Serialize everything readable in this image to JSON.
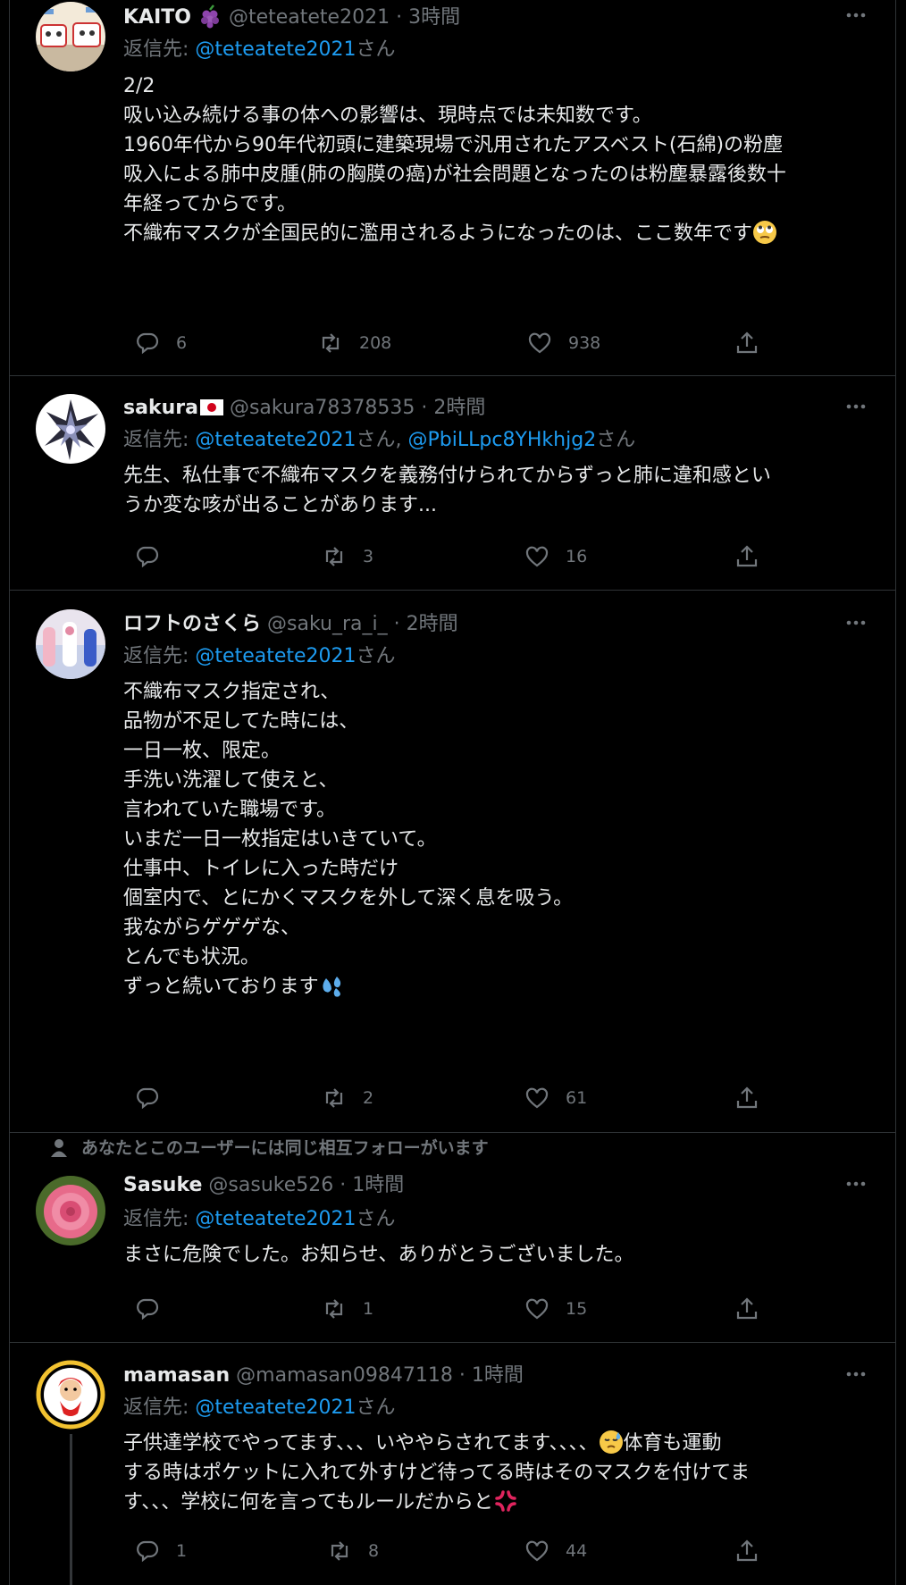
{
  "tweets": [
    {
      "name": "KAITO",
      "handle": "@teteatete2021",
      "time": "· 3時間",
      "reply_prefix": "返信先: ",
      "reply_mentions": "@teteatete2021",
      "reply_suffix": "さん",
      "lines": [
        "2/2",
        "吸い込み続ける事の体への影響は、現時点では未知数です。",
        "",
        "1960年代から90年代初頭に建築現場で汎用されたアスベスト(石綿)の粉塵",
        "吸入による肺中皮腫(肺の胸膜の癌)が社会問題となったのは粉塵暴露後数十",
        "年経ってからです。",
        "",
        "不織布マスクが全国民的に濫用されるようになったのは、ここ数年です"
      ],
      "replies": "6",
      "retweets": "208",
      "likes": "938",
      "name_emoji": "grapes-emoji",
      "end_emoji": "face-with-rolling-eyes-emoji"
    },
    {
      "name": "sakura",
      "handle": "@sakura78378535",
      "time": "· 2時間",
      "reply_prefix": "返信先: ",
      "reply_mentions": "@teteatete2021",
      "reply_mid": "さん, ",
      "reply_mentions2": "@PbiLLpc8YHkhjg2",
      "reply_suffix": "さん",
      "lines": [
        "先生、私仕事で不織布マスクを義務付けられてからずっと肺に違和感とい",
        "うか変な咳が出ることがあります..."
      ],
      "replies": "",
      "retweets": "3",
      "likes": "16",
      "name_emoji": "japan-flag-emoji"
    },
    {
      "name": "ロフトのさくら",
      "handle": "@saku_ra_i_",
      "time": "· 2時間",
      "reply_prefix": "返信先: ",
      "reply_mentions": "@teteatete2021",
      "reply_suffix": "さん",
      "lines": [
        "不織布マスク指定され、",
        "品物が不足してた時には、",
        "一日一枚、限定。",
        "手洗い洗濯して使えと、",
        "言われていた職場です。",
        "",
        "いまだ一日一枚指定はいきていて。",
        "",
        "仕事中、トイレに入った時だけ",
        "個室内で、とにかくマスクを外して深く息を吸う。",
        "我ながらゲゲゲな、",
        "とんでも状況。",
        "ずっと続いております"
      ],
      "replies": "",
      "retweets": "2",
      "likes": "61",
      "end_emoji": "sweat-droplets-emoji"
    },
    {
      "social_context": "あなたとこのユーザーには同じ相互フォローがいます",
      "name": "Sasuke",
      "handle": "@sasuke526",
      "time": "· 1時間",
      "reply_prefix": "返信先: ",
      "reply_mentions": "@teteatete2021",
      "reply_suffix": "さん",
      "lines": [
        "まさに危険でした。お知らせ、ありがとうございました。"
      ],
      "replies": "",
      "retweets": "1",
      "likes": "15"
    },
    {
      "name": "mamasan",
      "handle": "@mamasan09847118",
      "time": "· 1時間",
      "reply_prefix": "返信先: ",
      "reply_mentions": "@teteatete2021",
      "reply_suffix": "さん",
      "line1_a": "子供達学校でやってます、、、いややらされてます、、、、",
      "line1_b": "体育も運動",
      "lines_rest": [
        "する時はポケットに入れて外すけど待ってる時はそのマスクを付けてま",
        "す、、、学校に何を言ってもルールだからと"
      ],
      "replies": "1",
      "retweets": "8",
      "likes": "44",
      "mid_emoji": "downcast-face-with-sweat-emoji",
      "end_emoji": "anger-symbol-emoji"
    }
  ],
  "colors": {
    "background": "#000000",
    "text": "#e7e9ea",
    "secondary": "#71767b",
    "link": "#1d9bf0",
    "border": "#2f3336"
  }
}
